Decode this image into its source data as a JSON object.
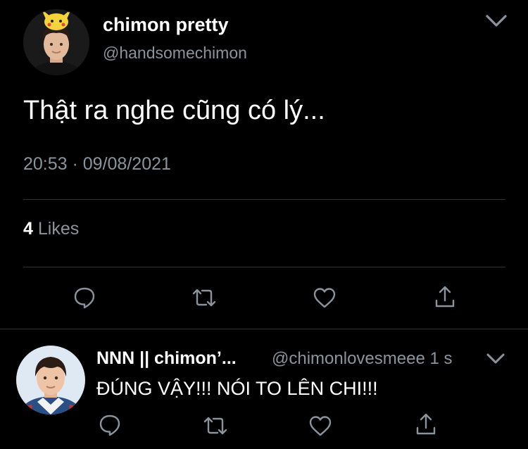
{
  "tweet": {
    "display_name": "chimon pretty",
    "handle": "@handsomechimon",
    "text": "Thật ra nghe cũng có lý...",
    "timestamp": "20:53 · 09/08/2021",
    "likes_count": "4",
    "likes_label": "Likes",
    "avatar": "avatar-photo-pikachu-hat",
    "menu_icon": "chevron-down-icon"
  },
  "actions": [
    {
      "icon": "reply-icon"
    },
    {
      "icon": "retweet-icon"
    },
    {
      "icon": "like-icon"
    },
    {
      "icon": "share-icon"
    }
  ],
  "reply": {
    "display_name": "NNN || chimon’...",
    "handle": "@chimonlovesmeee",
    "time_ago": "1 s",
    "text": "ĐÚNG VẬY!!! NÓI TO LÊN CHI!!!",
    "avatar": "avatar-photo"
  },
  "colors": {
    "background": "#000000",
    "primary_text": "#ffffff",
    "secondary_text": "#8a949d",
    "divider": "#2f3336",
    "icon": "#8a949d"
  }
}
